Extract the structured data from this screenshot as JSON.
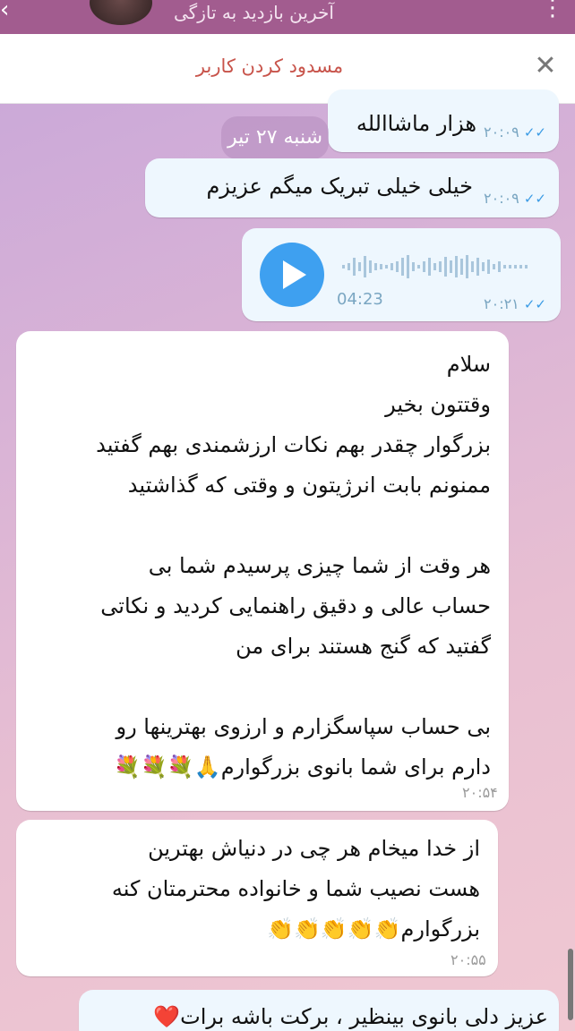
{
  "header": {
    "status": "آخرین بازدید به تازگی",
    "back_icon": "‹",
    "menu_icon": "⋮"
  },
  "block_bar": {
    "label": "مسدود کردن کاربر",
    "close_icon": "✕"
  },
  "date_chip": "شنبه ۲۷ تیر",
  "messages": [
    {
      "direction": "out",
      "text": "هزار ماشاالله",
      "time": "۲۰:۰۹",
      "status": "read"
    },
    {
      "direction": "out",
      "text": "خیلی خیلی تبریک میگم عزیزم",
      "time": "۲۰:۰۹",
      "status": "read"
    },
    {
      "direction": "out",
      "type": "voice",
      "duration": "04:23",
      "time": "۲۰:۲۱",
      "status": "read"
    },
    {
      "direction": "in",
      "lines": [
        "سلام",
        "وقتتون بخیر",
        "بزرگوار چقدر بهم نکات ارزشمندی بهم گفتید",
        "ممنونم بابت انرژیتون و وقتی که گذاشتید",
        "",
        "هر وقت از شما چیزی پرسیدم شما بی",
        "حساب عالی و دقیق راهنمایی کردید و نکاتی",
        "گفتید که گنج هستند برای من",
        "",
        "بی حساب سپاسگزارم و ارزوی بهترینها رو",
        "دارم برای شما بانوی بزرگوارم🙏💐💐💐"
      ],
      "time": "۲۰:۵۴"
    },
    {
      "direction": "in",
      "lines": [
        "از خدا میخام هر چی در دنیاش بهترین",
        "هست نصیب شما و خانواده محترمتان کنه",
        "بزرگوارم👏👏👏👏👏"
      ],
      "time": "۲۰:۵۵"
    },
    {
      "direction": "out",
      "text": "عزیز دلی بانوی بینظیر ، برکت باشه برات❤️"
    }
  ],
  "colors": {
    "header": "#a25c8f",
    "block_label": "#c8544b",
    "outgoing_bubble": "#eef7fe",
    "incoming_bubble": "#ffffff",
    "read_check": "#3b9be5",
    "play_button": "#3ea0f0"
  }
}
